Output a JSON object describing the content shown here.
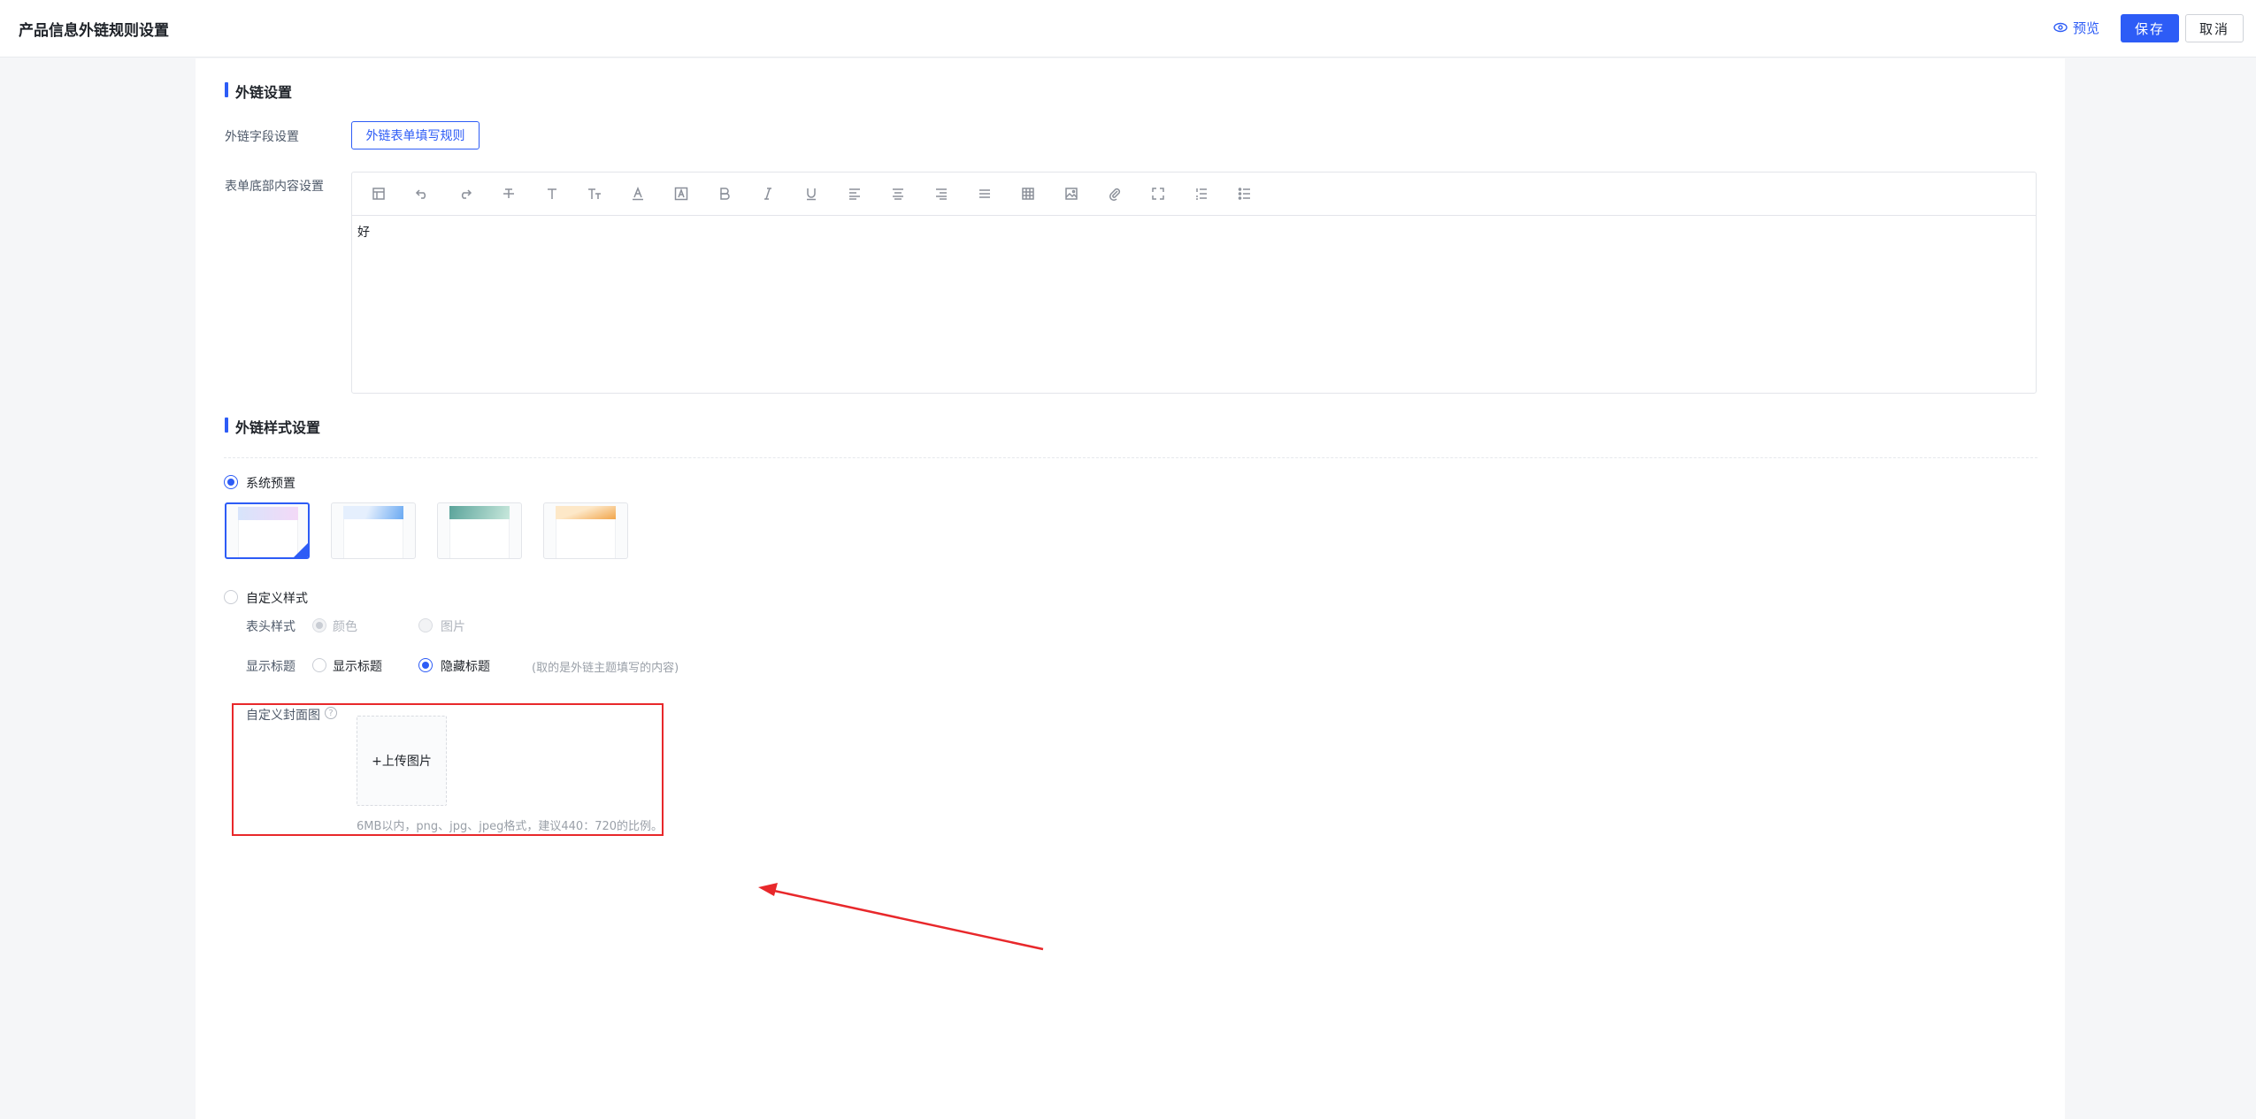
{
  "header": {
    "title": "产品信息外链规则设置",
    "preview_label": "预览",
    "save_label": "保存",
    "cancel_label": "取消"
  },
  "link_settings": {
    "section_title": "外链设置",
    "field_label": "外链字段设置",
    "rule_button": "外链表单填写规则",
    "footer_label": "表单底部内容设置",
    "editor_content": "好",
    "toolbar_icons": [
      "template-icon",
      "undo-icon",
      "redo-icon",
      "strikethrough-icon",
      "text-icon",
      "font-size-icon",
      "font-color-icon",
      "background-color-icon",
      "bold-icon",
      "italic-icon",
      "underline-icon",
      "align-left-icon",
      "align-center-icon",
      "align-right-icon",
      "justify-icon",
      "table-icon",
      "image-icon",
      "attachment-icon",
      "fullscreen-icon",
      "ordered-list-icon",
      "unordered-list-icon"
    ]
  },
  "style_settings": {
    "section_title": "外链样式设置",
    "preset_label": "系统预置",
    "themes": [
      {
        "name": "theme-light-purple",
        "colors": [
          "#d7e4fb",
          "#f3d9f7"
        ],
        "selected": true
      },
      {
        "name": "theme-blue",
        "colors": [
          "#e5effd",
          "#6aa9f2"
        ],
        "selected": false
      },
      {
        "name": "theme-green",
        "colors": [
          "#5aa39a",
          "#c8e8dc"
        ],
        "selected": false
      },
      {
        "name": "theme-orange",
        "colors": [
          "#fde8c8",
          "#f1a54a"
        ],
        "selected": false
      }
    ],
    "custom_label": "自定义样式",
    "header_style_label": "表头样式",
    "header_style_options": [
      "颜色",
      "图片"
    ],
    "show_title_label": "显示标题",
    "show_title_options": [
      "显示标题",
      "隐藏标题"
    ],
    "show_title_selected": "隐藏标题",
    "title_hint": "(取的是外链主题填写的内容)",
    "cover_label": "自定义封面图",
    "upload_label": "+上传图片",
    "upload_hint": "6MB以内，png、jpg、jpeg格式，建议440：720的比例。"
  },
  "colors": {
    "accent": "#2d5cf6",
    "annotation": "#e8282b"
  }
}
